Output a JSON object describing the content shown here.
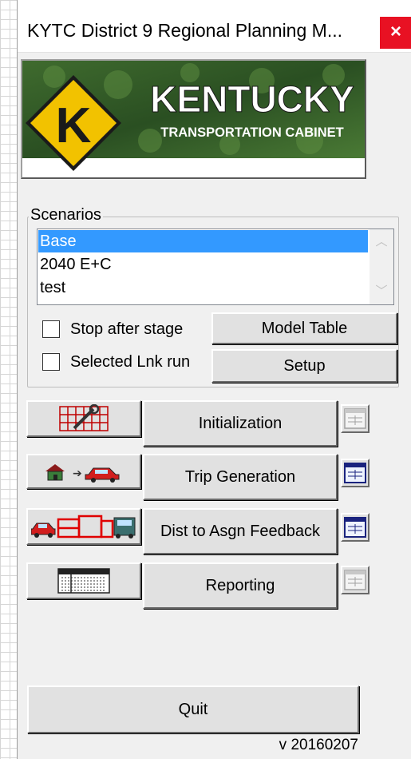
{
  "window": {
    "title": "KYTC District 9 Regional Planning M...",
    "close_glyph": "×"
  },
  "logo": {
    "brand_line1": "KENTUCKY",
    "brand_line2": "TRANSPORTATION CABINET",
    "mark_letter": "K",
    "colors": {
      "sign": "#f2c200",
      "green": "#2e5a24"
    }
  },
  "scenarios": {
    "group_label": "Scenarios",
    "items": [
      "Base",
      "2040 E+C",
      "test"
    ],
    "selected": "Base",
    "stop_after_stage_label": "Stop after stage",
    "stop_after_stage_checked": false,
    "selected_lnk_run_label": "Selected Lnk run",
    "selected_lnk_run_checked": false,
    "model_table_label": "Model Table",
    "setup_label": "Setup"
  },
  "stages": [
    {
      "label": "Initialization",
      "icon": "network-wrench-icon",
      "status_icon": "table-icon",
      "status": "inactive"
    },
    {
      "label": "Trip Generation",
      "icon": "house-to-car-icon",
      "status_icon": "table-icon",
      "status": "active"
    },
    {
      "label": "Dist to Asgn Feedback",
      "icon": "car-zones-truck-icon",
      "status_icon": "table-icon",
      "status": "active"
    },
    {
      "label": "Reporting",
      "icon": "report-grid-icon",
      "status_icon": "table-icon",
      "status": "inactive"
    }
  ],
  "footer": {
    "quit_label": "Quit",
    "version": "v 20160207"
  },
  "colors": {
    "selection": "#3399ff",
    "close_red": "#e81123",
    "status_active_border": "#1a237e"
  }
}
